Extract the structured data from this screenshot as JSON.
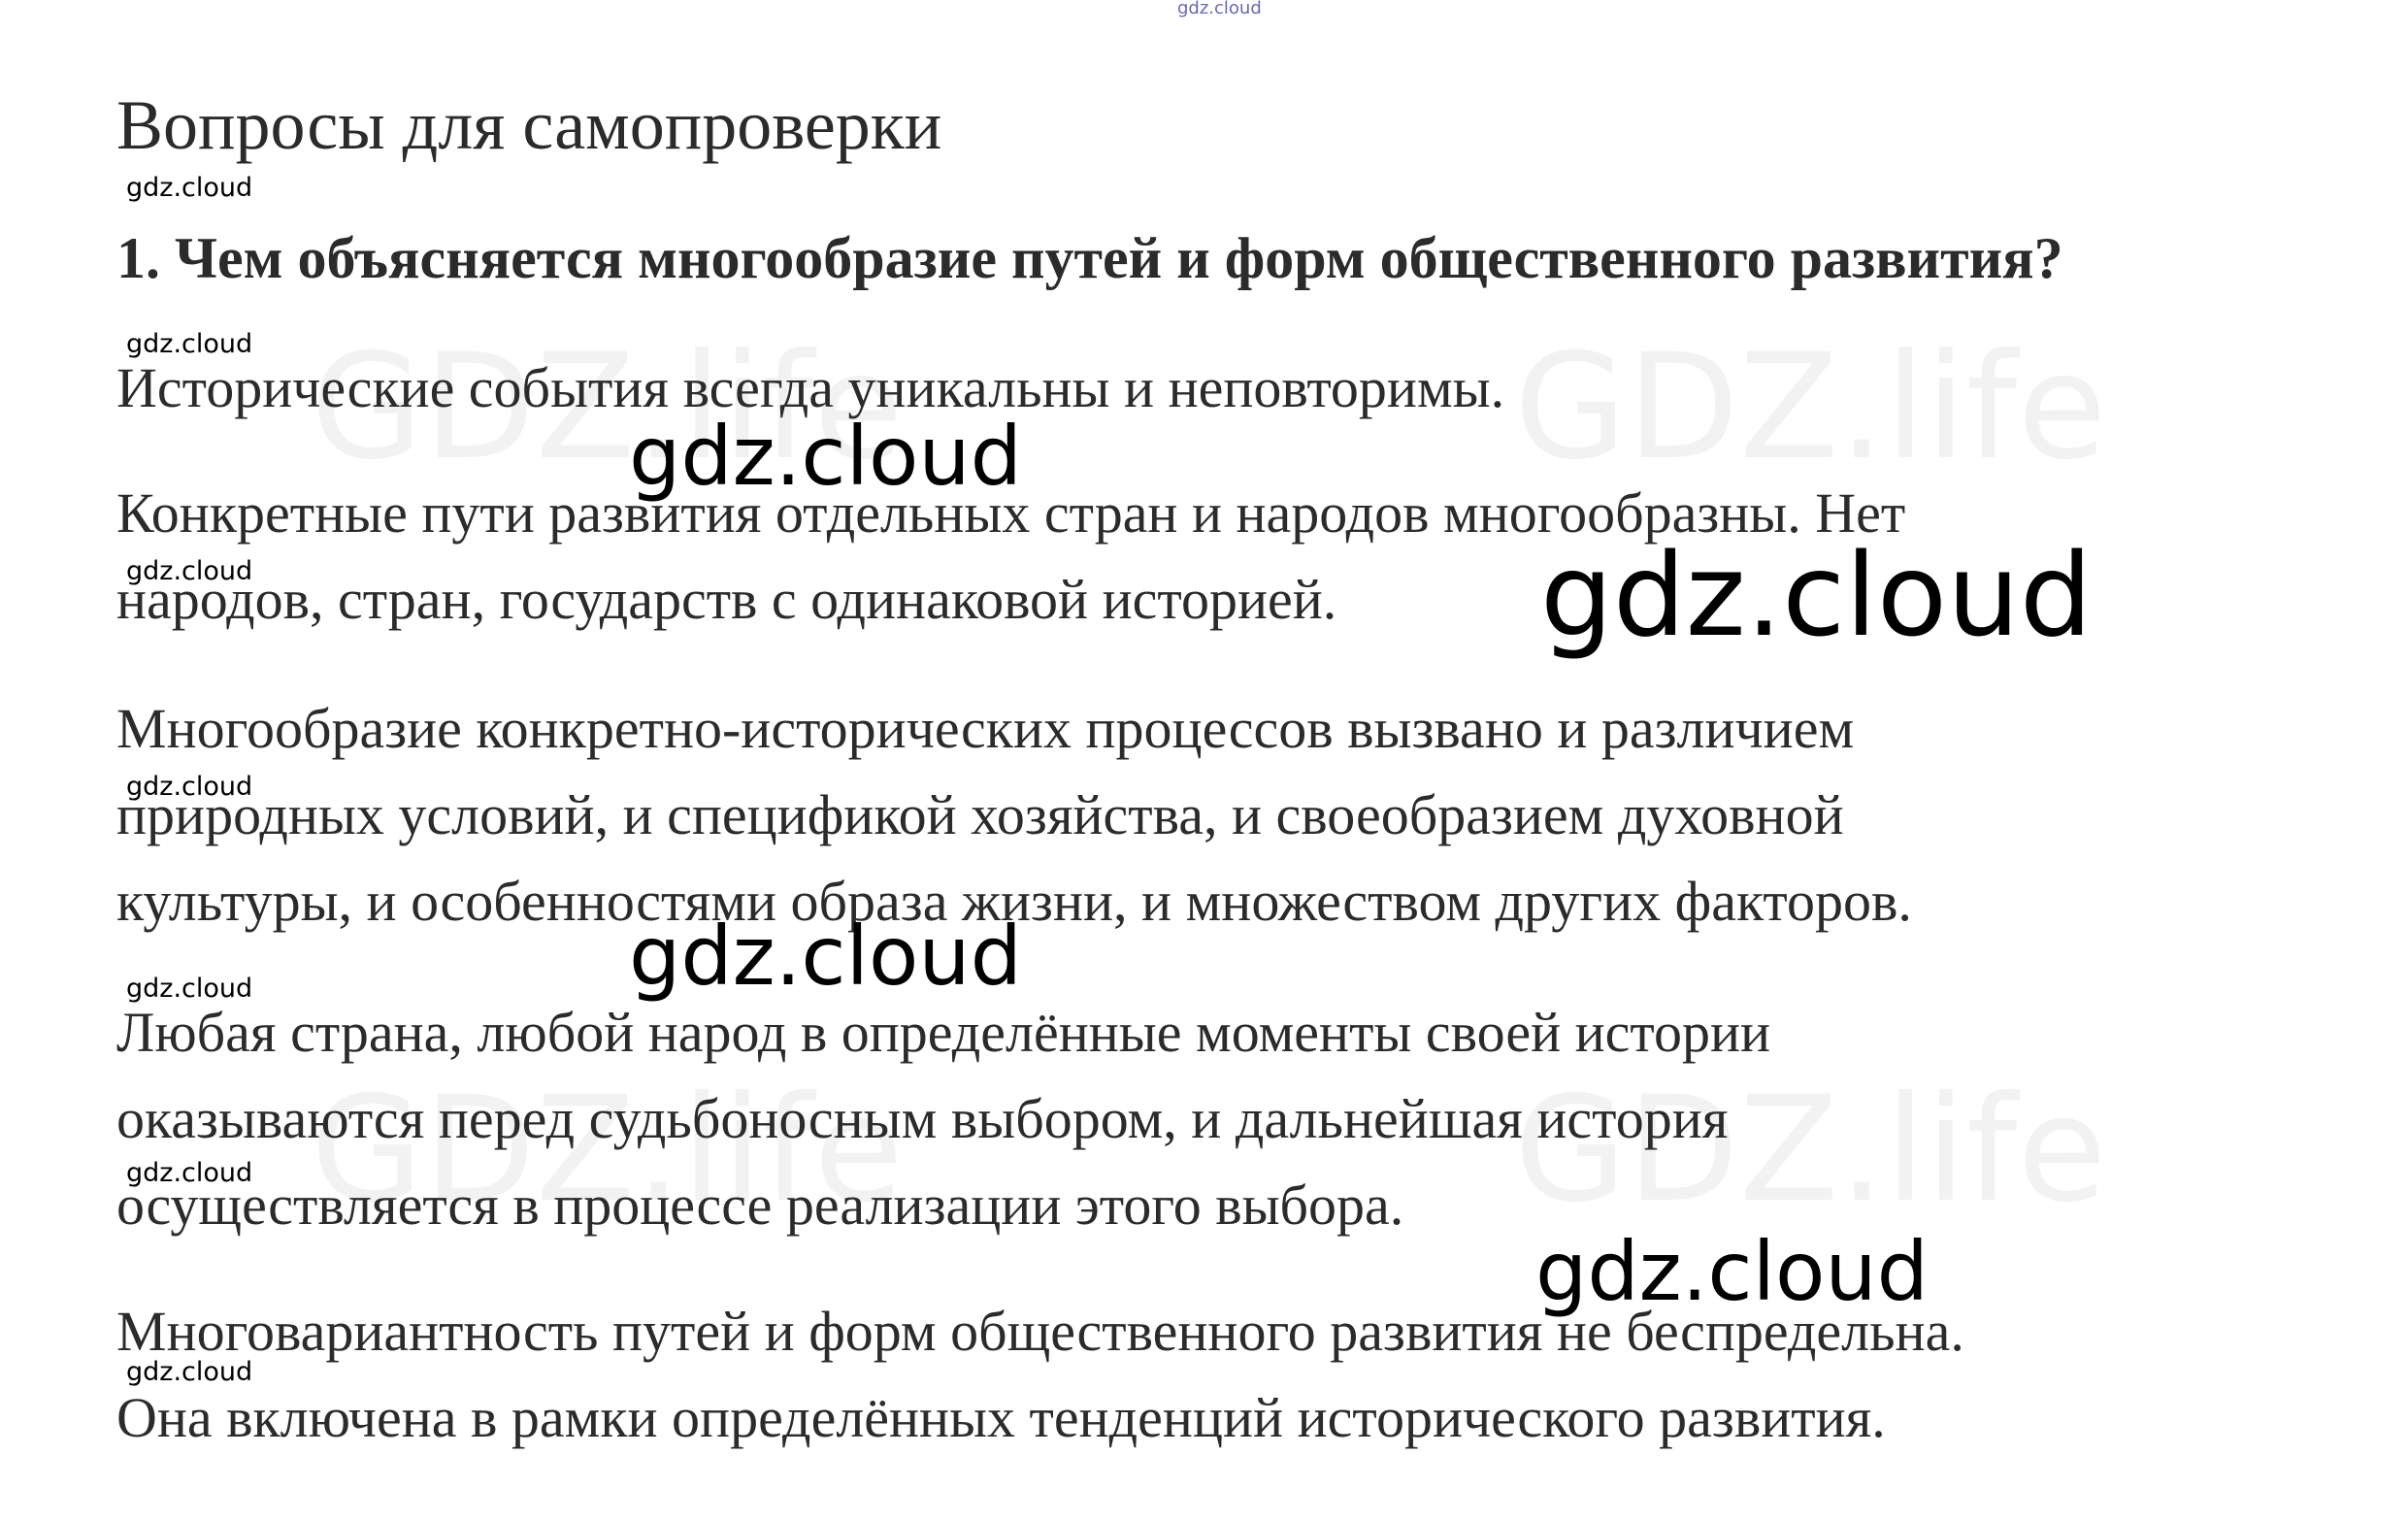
{
  "watermarks": {
    "top": "gdz.cloud",
    "small": "gdz.cloud",
    "mid": "gdz.cloud",
    "big": "gdz.cloud",
    "ghost": "GDZ.life"
  },
  "heading": "Вопросы для самопроверки",
  "question": "1. Чем объясняется многообразие путей и форм общественного развития?",
  "answer": {
    "p1": [
      "Исторические события всегда уникальны и неповторимы."
    ],
    "p2": [
      "Конкретные пути развития отдельных стран и народов многообразны. Нет",
      "народов, стран, государств с одинаковой историей."
    ],
    "p3": [
      "Многообразие конкретно-исторических процессов вызвано и различием",
      "природных условий, и спецификой хозяйства, и своеобразием духовной",
      "культуры, и особенностями образа жизни, и множеством других факторов."
    ],
    "p4": [
      "Любая страна, любой народ в определённые моменты своей истории",
      "оказываются перед судьбоносным выбором, и дальнейшая история",
      "осуществляется в процессе реализации этого выбора."
    ],
    "p5": [
      "Многовариантность путей и форм общественного развития не беспредельна.",
      "Она включена в рамки определённых тенденций исторического развития."
    ]
  }
}
